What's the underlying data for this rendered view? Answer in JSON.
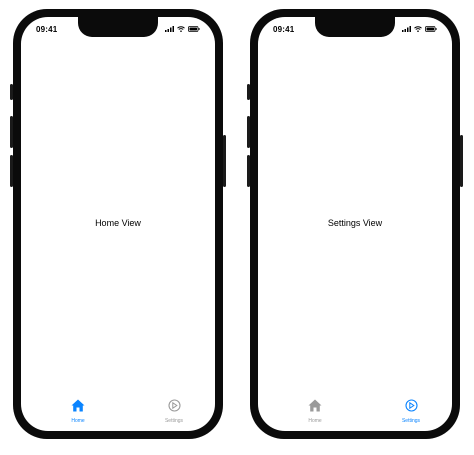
{
  "colors": {
    "active": "#0a84ff",
    "inactive": "#9a9a9a"
  },
  "phones": [
    {
      "status": {
        "time": "09:41"
      },
      "content": {
        "label": "Home View"
      },
      "tabs": [
        {
          "label": "Home",
          "icon": "house-icon",
          "state": "active"
        },
        {
          "label": "Settings",
          "icon": "gear-icon",
          "state": "inactive"
        }
      ]
    },
    {
      "status": {
        "time": "09:41"
      },
      "content": {
        "label": "Settings View"
      },
      "tabs": [
        {
          "label": "Home",
          "icon": "house-icon",
          "state": "inactive"
        },
        {
          "label": "Settings",
          "icon": "gear-icon",
          "state": "active"
        }
      ]
    }
  ]
}
